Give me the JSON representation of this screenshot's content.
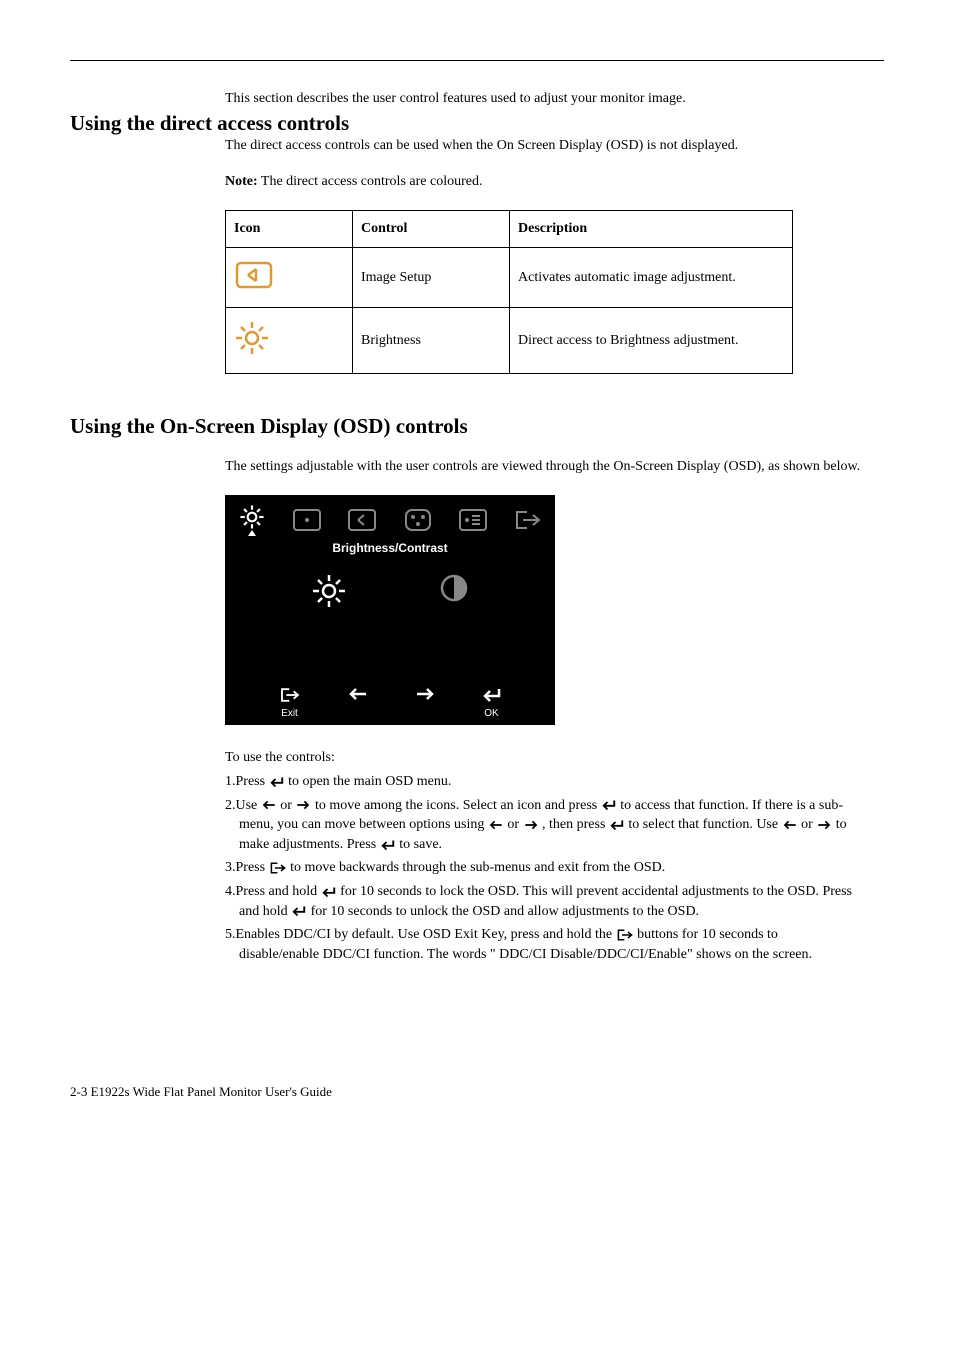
{
  "intro1": "This section describes the user control features used to adjust your monitor image.",
  "h_direct": "Using the direct access controls",
  "direct_p1": "The direct access controls can be used when the On Screen Display (OSD) is not displayed.",
  "direct_note_prefix": "Note:",
  "direct_note": " The direct access controls are coloured.",
  "table": {
    "headers": [
      "Icon",
      "Control",
      "Description"
    ],
    "rows": [
      {
        "icon": "image-setup",
        "control": "Image Setup",
        "desc": "Activates automatic image adjustment."
      },
      {
        "icon": "brightness",
        "control": "Brightness",
        "desc": "Direct access to Brightness adjustment."
      }
    ]
  },
  "h_osd": "Using the On-Screen Display (OSD) controls",
  "osd_p1": "The settings adjustable with the user controls are viewed through the On-Screen Display (OSD), as shown below.",
  "osd_panel": {
    "title": "Brightness/Contrast",
    "exit_label": "Exit",
    "ok_label": "OK"
  },
  "instructions": {
    "intro": "To use the controls:",
    "step1_a": "1.Press  ",
    "step1_b": "  to open the main OSD menu.",
    "step2_a": "2.Use  ",
    "step2_b": "  or  ",
    "step2_c": "  to move among the icons. Select an icon and press  ",
    "step2_d": "  to access that function. If there is a sub-menu, you can move between options using  ",
    "step2_e": "  or  ",
    "step2_f": "  , then press  ",
    "step2_g": "  to select that function. Use  ",
    "step2_h": "  or  ",
    "step2_i": "  to make adjustments.   Press  ",
    "step2_j": "  to save.",
    "step3_a": "3.Press   ",
    "step3_b": "  to move backwards through the sub-menus and exit from the OSD.",
    "step4_a": "4.Press and hold  ",
    "step4_b": "   for 10 seconds to lock the OSD. This will prevent accidental adjustments to the OSD. Press and hold  ",
    "step4_c": "   for 10 seconds to unlock the OSD and allow adjustments to the OSD.",
    "step5_a": "5.Enables DDC/CI by default. Use OSD Exit Key, press and hold the ",
    "step5_b": "  buttons for 10 seconds to disable/enable DDC/CI function. The words \" DDC/CI Disable/DDC/CI/Enable\" shows on the screen."
  },
  "footer": "2-3 E1922s Wide Flat Panel Monitor User's Guide"
}
